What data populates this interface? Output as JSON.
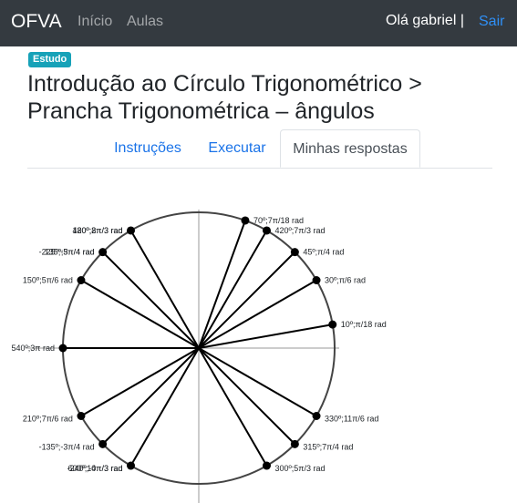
{
  "navbar": {
    "brand": "OFVA",
    "links": [
      "Início",
      "Aulas"
    ],
    "greeting": "Olá gabriel |",
    "logout": "Sair"
  },
  "badge": "Estudo",
  "title": "Introdução ao Círculo Trigonométrico > Prancha Trigonométrica – ângulos",
  "tabs": [
    {
      "label": "Instruções",
      "active": false
    },
    {
      "label": "Executar",
      "active": false
    },
    {
      "label": "Minhas respostas",
      "active": true
    }
  ],
  "colors": {
    "navbar_bg": "#343a40",
    "link_blue": "#1a73e8",
    "badge_bg": "#17a2b8"
  },
  "plot": {
    "points": [
      {
        "angle_deg": 70,
        "label": "70º;7π/18 rad"
      },
      {
        "angle_deg": 60,
        "label": "420º;7π/3 rad"
      },
      {
        "angle_deg": 45,
        "label": "45º;π/4 rad"
      },
      {
        "angle_deg": 30,
        "label": "30º;π/6 rad"
      },
      {
        "angle_deg": 10,
        "label": "10º;π/18 rad"
      },
      {
        "angle_deg": -30,
        "label": "330º;11π/6 rad"
      },
      {
        "angle_deg": -45,
        "label": "315º;7π/4 rad"
      },
      {
        "angle_deg": -60,
        "label": "300º;5π/3 rad"
      },
      {
        "angle_deg": -120,
        "label": "600º;10π/3 rad"
      },
      {
        "angle_deg": -120,
        "label": "-240º;-4π/3 rad"
      },
      {
        "angle_deg": -135,
        "label": "-135º;-3π/4 rad"
      },
      {
        "angle_deg": -150,
        "label": "210º;7π/6 rad"
      },
      {
        "angle_deg": 180,
        "label": "540º;3π rad"
      },
      {
        "angle_deg": 150,
        "label": "150º;5π/6 rad"
      },
      {
        "angle_deg": 135,
        "label": "-225º;-5π/4 rad"
      },
      {
        "angle_deg": 135,
        "label": "135º;3π/4 rad"
      },
      {
        "angle_deg": 120,
        "label": "480º;8π/3 rad"
      },
      {
        "angle_deg": 120,
        "label": "120º;2π/3 rad"
      }
    ]
  }
}
